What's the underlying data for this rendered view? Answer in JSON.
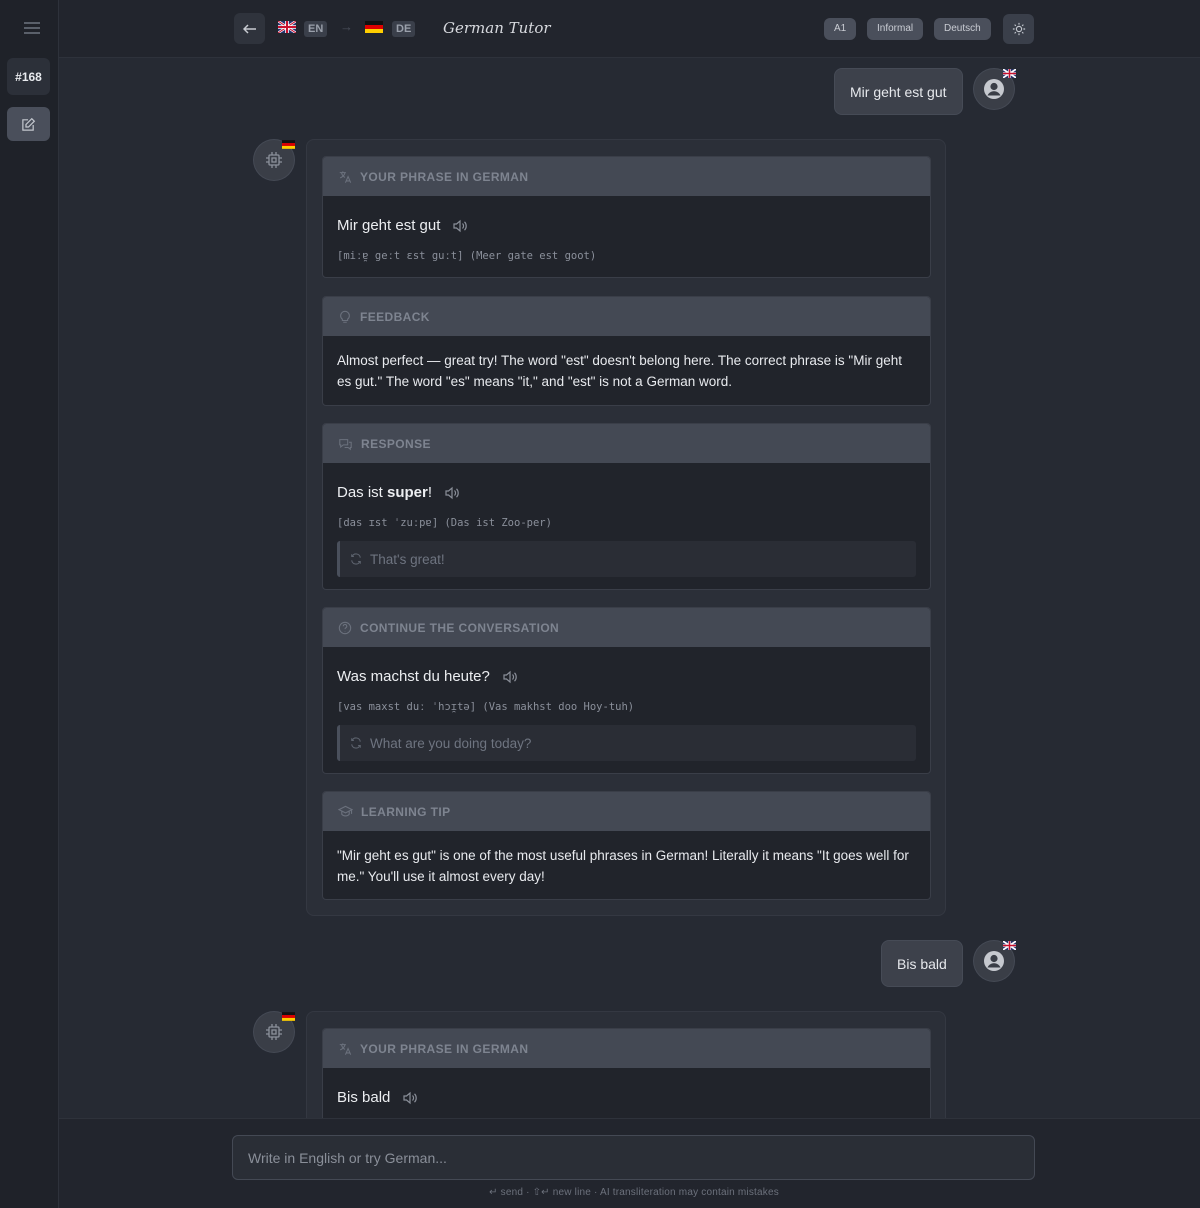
{
  "sidebar": {
    "conversation_id": "#168"
  },
  "header": {
    "source_lang": "EN",
    "target_lang": "DE",
    "title": "German Tutor",
    "level": "A1",
    "register": "Informal",
    "ui_lang": "Deutsch"
  },
  "messages": [
    {
      "user_text": "Mir geht est gut",
      "sections": {
        "phrase_heading": "YOUR PHRASE IN GERMAN",
        "phrase": "Mir geht est gut",
        "phrase_translit": "[miːɐ̯ geːt ɛst guːt] (Meer gate est goot)",
        "feedback_heading": "FEEDBACK",
        "feedback": "Almost perfect — great try! The word \"est\" doesn't belong here. The correct phrase is \"Mir geht es gut.\" The word \"es\" means \"it,\" and \"est\" is not a German word.",
        "response_heading": "RESPONSE",
        "response_prefix": "Das ist ",
        "response_bold": "super",
        "response_suffix": "!",
        "response_translit": "[das ɪst ˈzuːpɐ] (Das ist Zoo-per)",
        "response_translation": "That's great!",
        "continue_heading": "CONTINUE THE CONVERSATION",
        "continue_phrase": "Was machst du heute?",
        "continue_translit": "[vas maxst duː ˈhɔɪ̯tə] (Vas makhst doo Hoy-tuh)",
        "continue_translation": "What are you doing today?",
        "tip_heading": "LEARNING TIP",
        "tip": "\"Mir geht es gut\" is one of the most useful phrases in German! Literally it means \"It goes well for me.\" You'll use it almost every day!"
      }
    },
    {
      "user_text": "Bis bald",
      "sections": {
        "phrase_heading": "YOUR PHRASE IN GERMAN",
        "phrase": "Bis bald"
      }
    }
  ],
  "composer": {
    "placeholder": "Write in English or try German...",
    "hint": "↵ send · ⇧↵ new line · AI transliteration may contain mistakes"
  },
  "colors": {
    "background": "#262a33",
    "header": "#22252d",
    "section_head": "#444954",
    "section_body": "#21242b",
    "pill": "#4a4f5b"
  }
}
